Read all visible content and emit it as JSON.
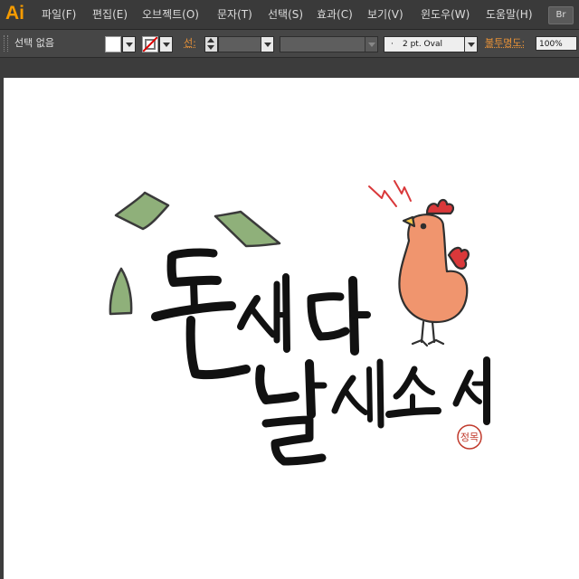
{
  "app": {
    "logo": "Ai"
  },
  "menu": {
    "items": [
      "파일(F)",
      "편집(E)",
      "오브젝트(O)",
      "문자(T)",
      "선택(S)",
      "효과(C)",
      "보기(V)",
      "윈도우(W)",
      "도움말(H)"
    ],
    "bridge_button": "Br"
  },
  "control_bar": {
    "selection_status": "선택 없음",
    "fill_color": "#ffffff",
    "stroke_label": "선:",
    "brush_value": "2 pt. Oval",
    "opacity_label": "불투명도:",
    "opacity_value": "100%"
  },
  "artwork": {
    "seal_text": "정목",
    "colors": {
      "leaf": "#8fb07a",
      "ink": "#111111",
      "rooster": "#f0956e",
      "comb": "#d9383a",
      "seal": "#c0392b"
    }
  }
}
